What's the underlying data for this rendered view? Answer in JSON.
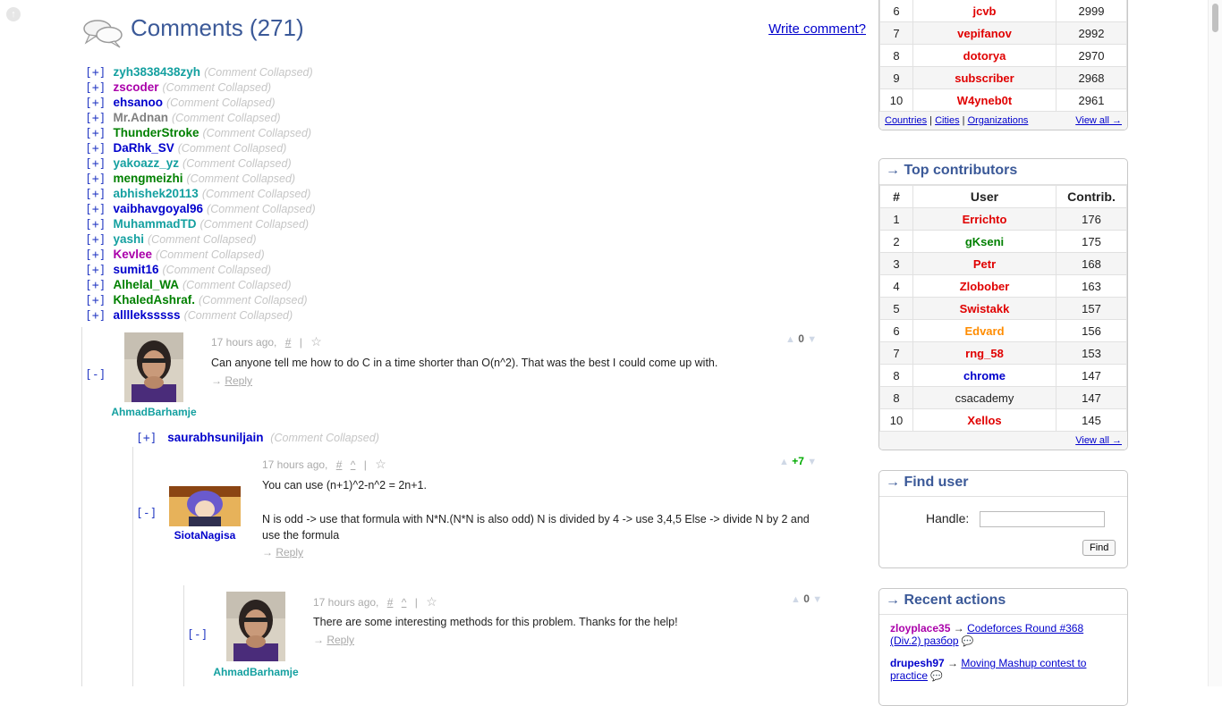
{
  "comments": {
    "title": "Comments (271)",
    "write_link": "Write comment?",
    "collapsed_note": "(Comment Collapsed)",
    "collapsed_toggle": "[+]",
    "expanded_toggle": "[-]",
    "collapsed": [
      {
        "user": "zyh3838438zyh",
        "color": "#14a0a0"
      },
      {
        "user": "zscoder",
        "color": "#aa00aa"
      },
      {
        "user": "ehsanoo",
        "color": "#0000cc"
      },
      {
        "user": "Mr.Adnan",
        "color": "#808080"
      },
      {
        "user": "ThunderStroke",
        "color": "#008000"
      },
      {
        "user": "DaRhk_SV",
        "color": "#0000cc"
      },
      {
        "user": "yakoazz_yz",
        "color": "#14a0a0"
      },
      {
        "user": "mengmeizhi",
        "color": "#008000"
      },
      {
        "user": "abhishek20113",
        "color": "#14a0a0"
      },
      {
        "user": "vaibhavgoyal96",
        "color": "#0000cc"
      },
      {
        "user": "MuhammadTD",
        "color": "#14a0a0"
      },
      {
        "user": "yashi",
        "color": "#14a0a0"
      },
      {
        "user": "Kevlee",
        "color": "#aa00aa"
      },
      {
        "user": "sumit16",
        "color": "#0000cc"
      },
      {
        "user": "Alhelal_WA",
        "color": "#008000"
      },
      {
        "user": "KhaledAshraf.",
        "color": "#008000"
      },
      {
        "user": "alllleksssss",
        "color": "#0000cc"
      }
    ],
    "c1": {
      "time": "17 hours ago,",
      "hash": "#",
      "bar": "|",
      "star": "☆",
      "vote": "0",
      "text": "Can anyone tell me how to do C in a time shorter than O(n^2). That was the best I could come up with.",
      "reply": "Reply",
      "user": "AhmadBarhamje",
      "user_color": "#14a0a0"
    },
    "c2_collapsed": {
      "user": "saurabhsuniljain",
      "color": "#0000cc"
    },
    "c2": {
      "time": "17 hours ago,",
      "hash": "#",
      "caret": "^",
      "bar": "|",
      "star": "☆",
      "vote": "+7",
      "text1": "You can use (n+1)^2-n^2 = 2n+1.",
      "text2": "N is odd -> use that formula with N*N.(N*N is also odd) N is divided by 4 -> use 3,4,5 Else -> divide N by 2 and use the formula",
      "reply": "Reply",
      "user": "SiotaNagisa",
      "user_color": "#0000cc"
    },
    "c3": {
      "time": "17 hours ago,",
      "hash": "#",
      "caret": "^",
      "bar": "|",
      "star": "☆",
      "vote": "0",
      "text": "There are some interesting methods for this problem. Thanks for the help!",
      "reply": "Reply",
      "user": "AhmadBarhamje",
      "user_color": "#14a0a0"
    }
  },
  "rating_tail": {
    "rows": [
      {
        "rank": "6",
        "user": "jcvb",
        "value": "2999",
        "color": "#e00000"
      },
      {
        "rank": "7",
        "user": "vepifanov",
        "value": "2992",
        "color": "#e00000"
      },
      {
        "rank": "8",
        "user": "dotorya",
        "value": "2970",
        "color": "#e00000"
      },
      {
        "rank": "9",
        "user": "subscriber",
        "value": "2968",
        "color": "#e00000"
      },
      {
        "rank": "10",
        "user": "W4yneb0t",
        "value": "2961",
        "color": "#e00000"
      }
    ],
    "links": [
      "Countries",
      "Cities",
      "Organizations"
    ],
    "sep": "|",
    "view_all": "View all →"
  },
  "contributors": {
    "title": "→ Top contributors",
    "headers": [
      "#",
      "User",
      "Contrib."
    ],
    "rows": [
      {
        "rank": "1",
        "user": "Errichto",
        "value": "176",
        "color": "#e00000"
      },
      {
        "rank": "2",
        "user": "gKseni",
        "value": "175",
        "color": "#008000"
      },
      {
        "rank": "3",
        "user": "Petr",
        "value": "168",
        "color": "#e00000"
      },
      {
        "rank": "4",
        "user": "Zlobober",
        "value": "163",
        "color": "#e00000"
      },
      {
        "rank": "5",
        "user": "Swistakk",
        "value": "157",
        "color": "#e00000"
      },
      {
        "rank": "6",
        "user": "Edvard",
        "value": "156",
        "color": "#ff8c00"
      },
      {
        "rank": "7",
        "user": "rng_58",
        "value": "153",
        "color": "#e00000"
      },
      {
        "rank": "8",
        "user": "chrome",
        "value": "147",
        "color": "#0000cc"
      },
      {
        "rank": "8",
        "user": "csacademy",
        "value": "147",
        "color": "#222222"
      },
      {
        "rank": "10",
        "user": "Xellos",
        "value": "145",
        "color": "#e00000"
      }
    ],
    "view_all": "View all →"
  },
  "find_user": {
    "title": "→ Find user",
    "label": "Handle:",
    "value": "",
    "button": "Find"
  },
  "recent": {
    "title": "→ Recent actions",
    "items": [
      {
        "user": "zloyplace35",
        "user_color": "#aa00aa",
        "arrow": "→",
        "link": "Codeforces Round #368 (Div.2) разбор"
      },
      {
        "user": "drupesh97",
        "user_color": "#0000cc",
        "arrow": "→",
        "link": "Moving Mashup contest to practice"
      }
    ]
  }
}
